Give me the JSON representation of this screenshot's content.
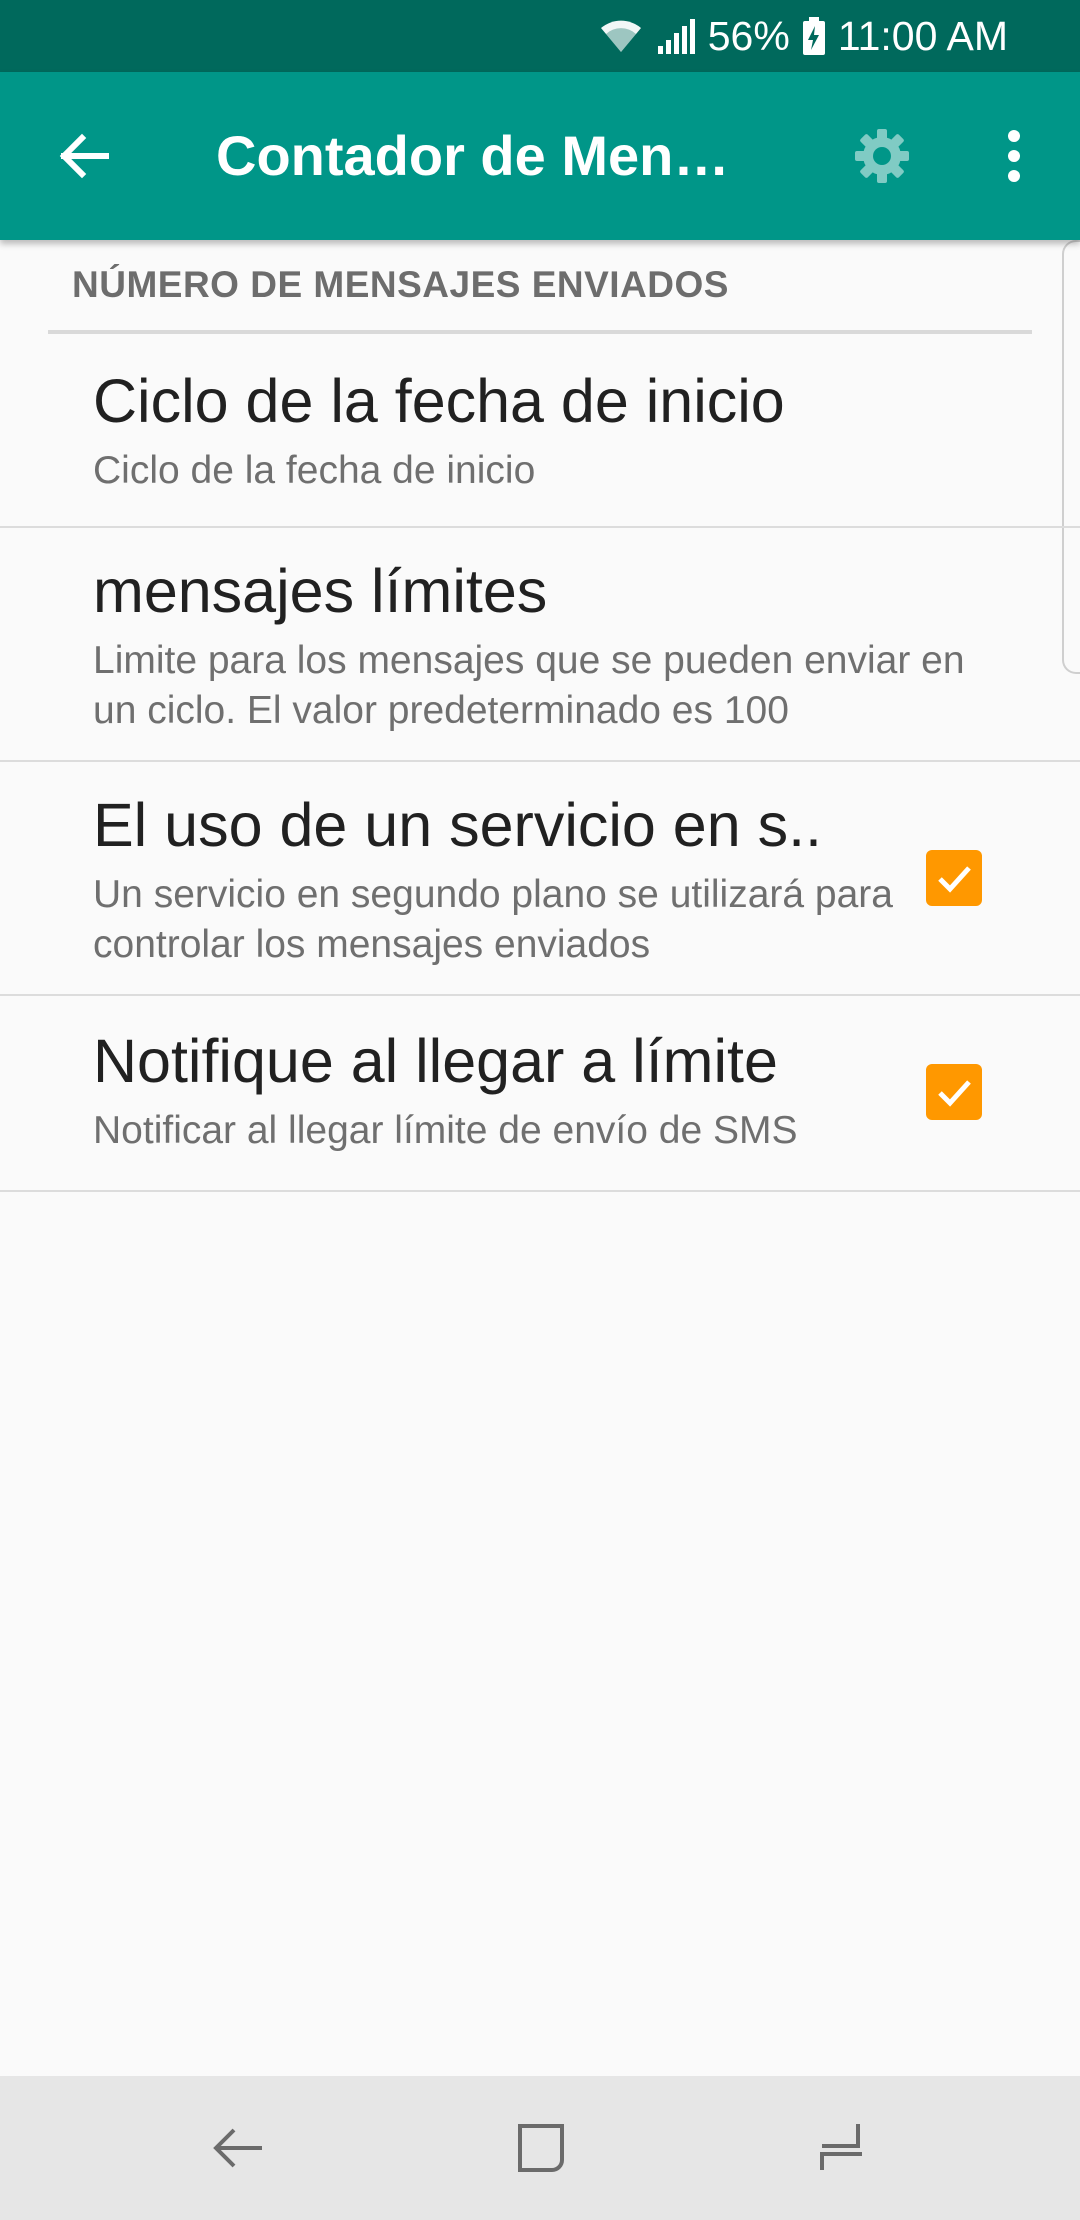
{
  "status_bar": {
    "battery_percent": "56%",
    "time": "11:00 AM",
    "icons": [
      "wifi-icon",
      "signal-icon",
      "battery-icon"
    ]
  },
  "app_bar": {
    "title": "Contador de Mensajes",
    "icons": [
      "back-arrow-icon",
      "gear-icon",
      "overflow-menu-icon"
    ]
  },
  "section": {
    "header": "NÚMERO DE MENSAJES ENVIADOS"
  },
  "preferences": [
    {
      "title": "Ciclo de la fecha de inicio",
      "summary": "Ciclo de la fecha de inicio"
    },
    {
      "title": "mensajes límites",
      "summary": "Limite para los mensajes que se pueden enviar en un ciclo. El valor predeterminado es 100"
    },
    {
      "title": "El uso de un servicio en s..",
      "summary": "Un servicio en segundo plano se utilizará para controlar los mensajes enviados",
      "checked": true
    },
    {
      "title": "Notifique al llegar a límite",
      "summary": "Notificar al llegar límite de envío de SMS",
      "checked": true
    }
  ],
  "nav_bar": {
    "icons": [
      "nav-back-icon",
      "nav-home-icon",
      "nav-recents-icon"
    ]
  },
  "colors": {
    "status_bar": "#00695c",
    "app_bar": "#009688",
    "checkbox": "#ff9800",
    "background": "#fafafa"
  }
}
